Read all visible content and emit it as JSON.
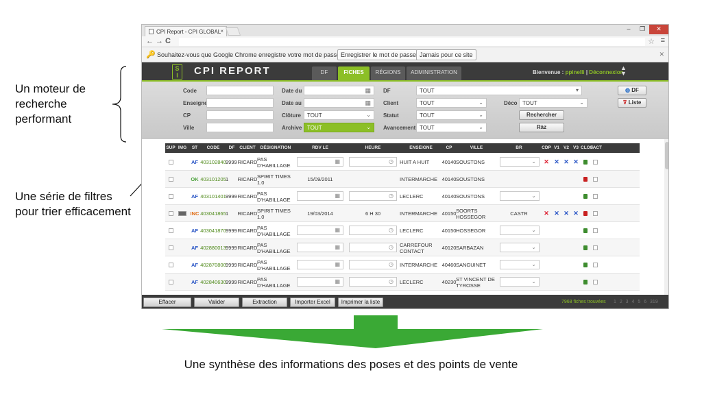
{
  "annotations": {
    "left_1": "Un moteur de recherche performant",
    "left_2": "Une série de filtres pour trier efficacement",
    "bottom": "Une synthèse des informations des poses et des points de vente"
  },
  "browser": {
    "tab_title": "CPI Report - CPI GLOBAL",
    "infobar_message": "Souhaitez-vous que Google Chrome enregistre votre mot de passe ?",
    "save_password": "Enregistrer le mot de passe",
    "never": "Jamais pour ce site"
  },
  "app": {
    "title": "CPI REPORT",
    "tabs": [
      "DF",
      "FICHES",
      "RÉGIONS",
      "ADMINISTRATION"
    ],
    "active_tab": "FICHES",
    "welcome": "Bienvenue :",
    "user": "ppinelli",
    "separator": "|",
    "logout": "Déconnexion",
    "colors": {
      "accent": "#8cbf26",
      "header": "#3b3b3b"
    }
  },
  "search": {
    "labels": {
      "code": "Code",
      "enseigne": "Enseigne",
      "cp": "CP",
      "ville": "Ville",
      "date_du": "Date du",
      "date_au": "Date au",
      "cloture": "Clôture",
      "archive": "Archive",
      "df": "DF",
      "client": "Client",
      "statut": "Statut",
      "avancement": "Avancement",
      "deco": "Déco"
    },
    "values": {
      "cloture": "TOUT",
      "archive": "TOUT",
      "df": "TOUT",
      "client": "TOUT",
      "statut": "TOUT",
      "avancement": "TOUT",
      "deco": "TOUT"
    },
    "buttons": {
      "rechercher": "Rechercher",
      "raz": "Ràz",
      "df": "DF",
      "liste": "Liste"
    }
  },
  "table": {
    "columns": [
      "SUP",
      "IMG",
      "ST",
      "CODE",
      "DF",
      "CLIENT",
      "DÉSIGNATION",
      "RDV LE",
      "HEURE",
      "ENSEIGNE",
      "CP",
      "VILLE",
      "BR",
      "CDP",
      "V1",
      "V2",
      "V3",
      "CLOS",
      "FACT"
    ],
    "rows": [
      {
        "st": "AF",
        "code": "403102840",
        "df": "9999",
        "client": "RICARD",
        "designation": "PAS D'HABILLAGE",
        "rdv": "",
        "heure": "",
        "enseigne": "HUIT A HUIT",
        "cp": "40140",
        "ville": "SOUSTONS",
        "br": "",
        "marks": [
          "x",
          "x",
          "x",
          "x"
        ],
        "lock": "green"
      },
      {
        "st": "OK",
        "code": "403101205",
        "df": "1",
        "client": "RICARD",
        "designation": "SPIRIT TIMES 1.0",
        "rdv": "15/09/2011",
        "heure": "",
        "enseigne": "INTERMARCHE",
        "cp": "40140",
        "ville": "SOUSTONS",
        "br": "",
        "marks": [],
        "lock": "red"
      },
      {
        "st": "AF",
        "code": "403101401",
        "df": "9999",
        "client": "RICARD",
        "designation": "PAS D'HABILLAGE",
        "rdv": "",
        "heure": "",
        "enseigne": "LECLERC",
        "cp": "40140",
        "ville": "SOUSTONS",
        "br": "",
        "marks": [],
        "lock": "green"
      },
      {
        "st": "INC",
        "code": "403041865",
        "df": "1",
        "client": "RICARD",
        "designation": "SPIRIT TIMES 1.0",
        "rdv": "19/03/2014",
        "heure": "6 H 30",
        "enseigne": "INTERMARCHE",
        "cp": "40150",
        "ville": "SOORTS HOSSEGOR",
        "br": "CASTR",
        "marks": [
          "x",
          "x",
          "x",
          "x"
        ],
        "lock": "red"
      },
      {
        "st": "AF",
        "code": "403041870",
        "df": "9999",
        "client": "RICARD",
        "designation": "PAS D'HABILLAGE",
        "rdv": "",
        "heure": "",
        "enseigne": "LECLERC",
        "cp": "40150",
        "ville": "HOSSEGOR",
        "br": "",
        "marks": [],
        "lock": "green"
      },
      {
        "st": "AF",
        "code": "402880013",
        "df": "9999",
        "client": "RICARD",
        "designation": "PAS D'HABILLAGE",
        "rdv": "",
        "heure": "",
        "enseigne": "CARREFOUR CONTACT",
        "cp": "40120",
        "ville": "SARBAZAN",
        "br": "",
        "marks": [],
        "lock": "green"
      },
      {
        "st": "AF",
        "code": "402870800",
        "df": "9999",
        "client": "RICARD",
        "designation": "PAS D'HABILLAGE",
        "rdv": "",
        "heure": "",
        "enseigne": "INTERMARCHE",
        "cp": "40460",
        "ville": "SANGUINET",
        "br": "",
        "marks": [],
        "lock": "green"
      },
      {
        "st": "AF",
        "code": "402840630",
        "df": "9999",
        "client": "RICARD",
        "designation": "PAS D'HABILLAGE",
        "rdv": "",
        "heure": "",
        "enseigne": "LECLERC",
        "cp": "40230",
        "ville": "ST VINCENT DE TYROSSE",
        "br": "",
        "marks": [],
        "lock": "green"
      }
    ]
  },
  "bottom": {
    "buttons": [
      "Effacer",
      "Valider",
      "Extraction",
      "Importer Excel",
      "Imprimer la liste"
    ],
    "found": "7968 fiches trouvées",
    "pages": "1 2 3 4 5 6 319"
  }
}
